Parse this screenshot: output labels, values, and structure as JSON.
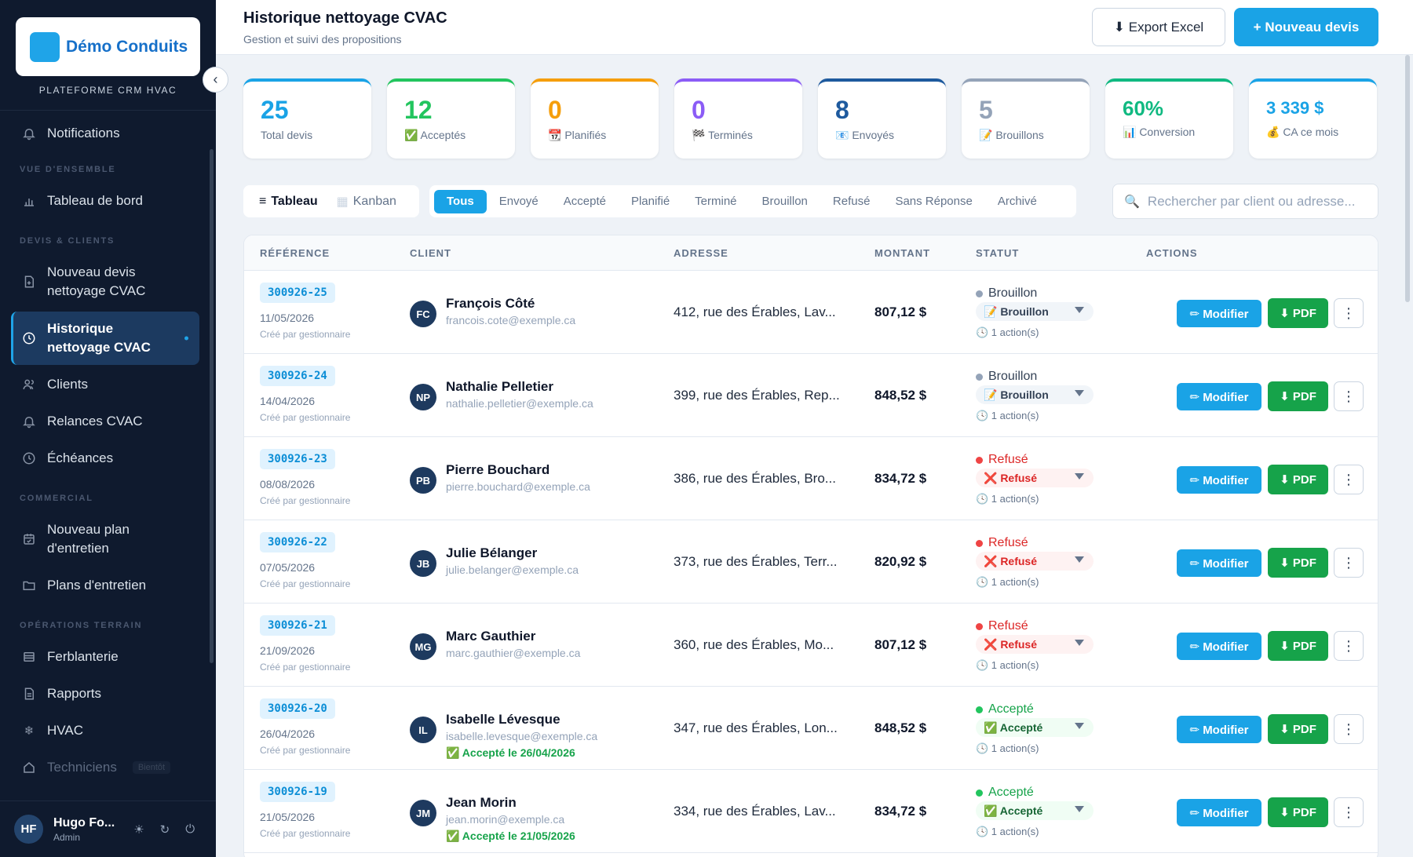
{
  "sidebar": {
    "brand": "Démo Conduits",
    "platform": "PLATEFORME CRM HVAC",
    "notifications": "Notifications",
    "sections": {
      "overview": "VUE D'ENSEMBLE",
      "quotes_clients": "DEVIS & CLIENTS",
      "commercial": "COMMERCIAL",
      "field_ops": "OPÉRATIONS TERRAIN"
    },
    "items": {
      "dashboard": "Tableau de bord",
      "new_quote": "Nouveau devis nettoyage CVAC",
      "history": "Historique nettoyage CVAC",
      "clients": "Clients",
      "reminders": "Relances CVAC",
      "deadlines": "Échéances",
      "new_plan": "Nouveau plan d'entretien",
      "plans": "Plans d'entretien",
      "sheet_metal": "Ferblanterie",
      "reports": "Rapports",
      "hvac": "HVAC",
      "technicians": "Techniciens",
      "soon": "Bientôt"
    },
    "user": {
      "initials": "HF",
      "name": "Hugo Fo...",
      "role": "Admin"
    }
  },
  "header": {
    "title": "Historique nettoyage CVAC",
    "subtitle": "Gestion et suivi des propositions",
    "export_label": "⬇ Export Excel",
    "new_label": "+ Nouveau devis"
  },
  "stats": [
    {
      "value": "25",
      "label": "Total devis",
      "color": "#1aa3e6"
    },
    {
      "value": "12",
      "label": "✅ Acceptés",
      "color": "#22c55e"
    },
    {
      "value": "0",
      "label": "📆 Planifiés",
      "color": "#f59e0b"
    },
    {
      "value": "0",
      "label": "🏁 Terminés",
      "color": "#8b5cf6"
    },
    {
      "value": "8",
      "label": "📧 Envoyés",
      "color": "#1e5a9e"
    },
    {
      "value": "5",
      "label": "📝 Brouillons",
      "color": "#94a3b8"
    },
    {
      "value": "60%",
      "label": "📊 Conversion",
      "color": "#10b981"
    },
    {
      "value": "3 339 $",
      "label": "💰 CA ce mois",
      "color": "#1aa3e6"
    }
  ],
  "views": {
    "table": "Tableau",
    "kanban": "Kanban"
  },
  "filters": [
    "Tous",
    "Envoyé",
    "Accepté",
    "Planifié",
    "Terminé",
    "Brouillon",
    "Refusé",
    "Sans Réponse",
    "Archivé"
  ],
  "search": {
    "placeholder": "Rechercher par client ou adresse...",
    "value": ""
  },
  "table": {
    "columns": {
      "reference": "RÉFÉRENCE",
      "client": "CLIENT",
      "address": "ADRESSE",
      "amount": "MONTANT",
      "status": "STATUT",
      "actions": "ACTIONS"
    },
    "modify_label": "✏ Modifier",
    "pdf_label": "⬇ PDF",
    "more_label": "⋮",
    "rows": [
      {
        "ref": "300926-25",
        "date": "11/05/2026",
        "created_by": "Créé par gestionnaire",
        "initials": "FC",
        "name": "François Côté",
        "email": "francois.cote@exemple.ca",
        "accepted": "",
        "address": "412, rue des Érables, Lav...",
        "amount": "807,12 $",
        "status_key": "draft",
        "status": "Brouillon",
        "status_select": "📝 Brouillon",
        "actions": "🕓 1 action(s)"
      },
      {
        "ref": "300926-24",
        "date": "14/04/2026",
        "created_by": "Créé par gestionnaire",
        "initials": "NP",
        "name": "Nathalie Pelletier",
        "email": "nathalie.pelletier@exemple.ca",
        "accepted": "",
        "address": "399, rue des Érables, Rep...",
        "amount": "848,52 $",
        "status_key": "draft",
        "status": "Brouillon",
        "status_select": "📝 Brouillon",
        "actions": "🕓 1 action(s)"
      },
      {
        "ref": "300926-23",
        "date": "08/08/2026",
        "created_by": "Créé par gestionnaire",
        "initials": "PB",
        "name": "Pierre Bouchard",
        "email": "pierre.bouchard@exemple.ca",
        "accepted": "",
        "address": "386, rue des Érables, Bro...",
        "amount": "834,72 $",
        "status_key": "ref",
        "status": "Refusé",
        "status_select": "❌ Refusé",
        "actions": "🕓 1 action(s)"
      },
      {
        "ref": "300926-22",
        "date": "07/05/2026",
        "created_by": "Créé par gestionnaire",
        "initials": "JB",
        "name": "Julie Bélanger",
        "email": "julie.belanger@exemple.ca",
        "accepted": "",
        "address": "373, rue des Érables, Terr...",
        "amount": "820,92 $",
        "status_key": "ref",
        "status": "Refusé",
        "status_select": "❌ Refusé",
        "actions": "🕓 1 action(s)"
      },
      {
        "ref": "300926-21",
        "date": "21/09/2026",
        "created_by": "Créé par gestionnaire",
        "initials": "MG",
        "name": "Marc Gauthier",
        "email": "marc.gauthier@exemple.ca",
        "accepted": "",
        "address": "360, rue des Érables, Mo...",
        "amount": "807,12 $",
        "status_key": "ref",
        "status": "Refusé",
        "status_select": "❌ Refusé",
        "actions": "🕓 1 action(s)"
      },
      {
        "ref": "300926-20",
        "date": "26/04/2026",
        "created_by": "Créé par gestionnaire",
        "initials": "IL",
        "name": "Isabelle Lévesque",
        "email": "isabelle.levesque@exemple.ca",
        "accepted": "✅ Accepté le 26/04/2026",
        "address": "347, rue des Érables, Lon...",
        "amount": "848,52 $",
        "status_key": "acc",
        "status": "Accepté",
        "status_select": "✅ Accepté",
        "actions": "🕓 1 action(s)"
      },
      {
        "ref": "300926-19",
        "date": "21/05/2026",
        "created_by": "Créé par gestionnaire",
        "initials": "JM",
        "name": "Jean Morin",
        "email": "jean.morin@exemple.ca",
        "accepted": "✅ Accepté le 21/05/2026",
        "address": "334, rue des Érables, Lav...",
        "amount": "834,72 $",
        "status_key": "acc",
        "status": "Accepté",
        "status_select": "✅ Accepté",
        "actions": "🕓 1 action(s)"
      }
    ]
  }
}
